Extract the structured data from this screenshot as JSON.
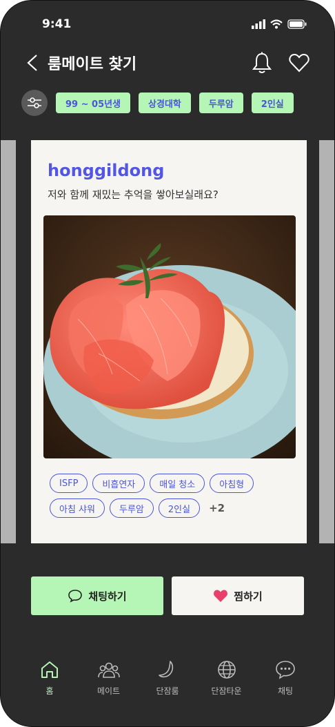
{
  "status_bar": {
    "time": "9:41"
  },
  "header": {
    "title": "룸메이트 찾기"
  },
  "filters": [
    "99 ~ 05년생",
    "상경대학",
    "두루암",
    "2인실"
  ],
  "card": {
    "username": "honggildong",
    "tagline": "저와 함께 재밌는 추억을 쌓아보실래요?",
    "photo_icon": "grapefruit-tart-photo",
    "tags": [
      "ISFP",
      "비흡연자",
      "매일 청소",
      "아침형",
      "아침 샤워",
      "두루암",
      "2인실"
    ],
    "more": "+2"
  },
  "actions": {
    "chat_label": "채팅하기",
    "like_label": "찜하기"
  },
  "tabs": [
    {
      "label": "홈",
      "icon": "home-icon",
      "active": true
    },
    {
      "label": "메이트",
      "icon": "people-icon",
      "active": false
    },
    {
      "label": "단잠룸",
      "icon": "moon-icon",
      "active": false
    },
    {
      "label": "단잠타운",
      "icon": "globe-icon",
      "active": false
    },
    {
      "label": "채팅",
      "icon": "chat-icon",
      "active": false
    }
  ],
  "colors": {
    "accent_green": "#b5f5b5",
    "accent_blue": "#4a55d8",
    "background": "#2b2b2b",
    "heart": "#e8406b"
  }
}
